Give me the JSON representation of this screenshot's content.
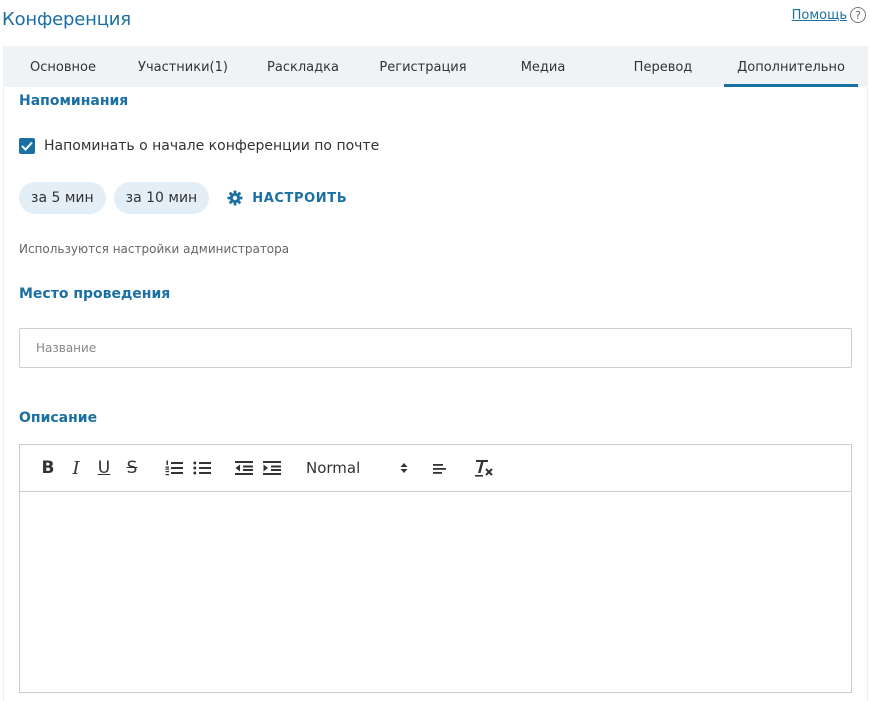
{
  "header": {
    "title": "Конференция",
    "help_label": "Помощь",
    "help_icon": "?"
  },
  "tabs": [
    {
      "label": "Основное",
      "active": false
    },
    {
      "label": "Участники(1)",
      "active": false
    },
    {
      "label": "Раскладка",
      "active": false
    },
    {
      "label": "Регистрация",
      "active": false
    },
    {
      "label": "Медиа",
      "active": false
    },
    {
      "label": "Перевод",
      "active": false
    },
    {
      "label": "Дополнительно",
      "active": true
    }
  ],
  "reminders": {
    "title": "Напоминания",
    "email_reminder_label": "Напоминать о начале конференции по почте",
    "email_reminder_checked": true,
    "chips": [
      "за 5 мин",
      "за 10 мин"
    ],
    "configure_label": "НАСТРОИТЬ",
    "note": "Используются настройки администратора"
  },
  "venue": {
    "title": "Место проведения",
    "placeholder": "Название",
    "value": ""
  },
  "description": {
    "title": "Описание",
    "toolbar": {
      "bold": "B",
      "italic": "I",
      "underline": "U",
      "strike": "S",
      "format_select": "Normal"
    },
    "content": ""
  },
  "colors": {
    "accent": "#1a6fa3",
    "tab_bar": "#f0f3f6",
    "chip": "#e3eef7",
    "border": "#c9ced3"
  }
}
